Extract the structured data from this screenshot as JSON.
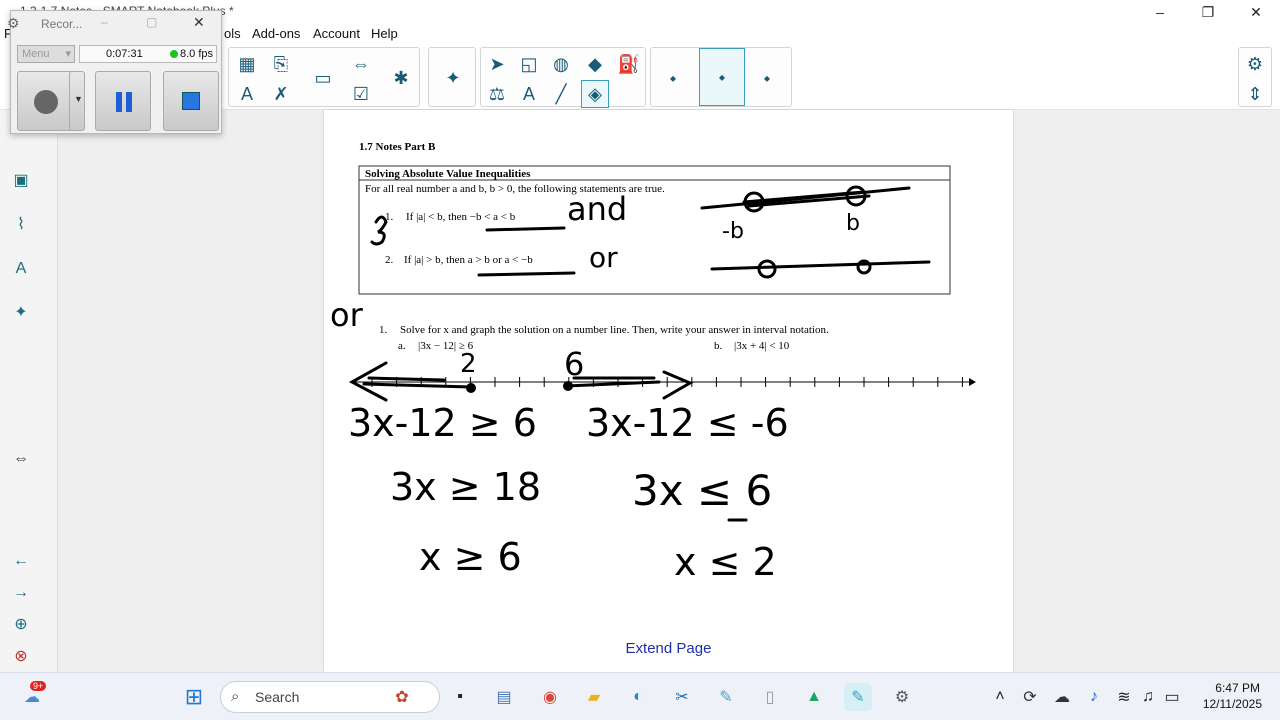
{
  "window": {
    "title": "1.3-1.7 Notes - SMART Notebook Plus *",
    "minimize_glyph": "–",
    "maximize_glyph": "❐",
    "close_glyph": "✕"
  },
  "menu": {
    "items": [
      "ols",
      "Add-ons",
      "Account",
      "Help"
    ],
    "partial_left": "F"
  },
  "recorder": {
    "title": "Recor...",
    "menu_label": "Menu",
    "elapsed": "0:07:31",
    "fps": "8.0 fps"
  },
  "page": {
    "heading": "1.7 Notes Part B",
    "box_title": "Solving Absolute Value Inequalities",
    "box_intro": "For all real number a and b, b > 0, the following statements are true.",
    "rule1_num": "1.",
    "rule1_text": "If |a| < b, then −b < a < b",
    "rule2_num": "2.",
    "rule2_text": "If |a| > b, then  a > b or a < −b",
    "problem_num": "1.",
    "problem_text": "Solve for x and graph the solution on a number line. Then, write your answer in interval notation.",
    "part_a_label": "a.",
    "part_a_expr": "|3x − 12|  ≥ 6",
    "part_b_label": "b.",
    "part_b_expr": "|3x + 4|  < 10",
    "extend_label": "Extend Page"
  },
  "handwriting": {
    "and": "and",
    "or_right": "or",
    "or_left": "or",
    "neg_b": "-b",
    "b": "b",
    "two": "2",
    "six": "6",
    "left_line1": "3x-12 ≥ 6",
    "left_line2": "3x ≥ 18",
    "left_line3": "x ≥ 6",
    "right_line1": "3x-12 ≤ -6",
    "right_line2": "3x ≤ 6",
    "right_line3": "x ≤ 2"
  },
  "taskbar": {
    "search_placeholder": "Search",
    "time": "6:47 PM",
    "date": "12/11/2025",
    "notif_badge": "9+"
  },
  "colors": {
    "accent": "#1b5b77",
    "ink": "#000000",
    "link": "#1f2fa8"
  }
}
